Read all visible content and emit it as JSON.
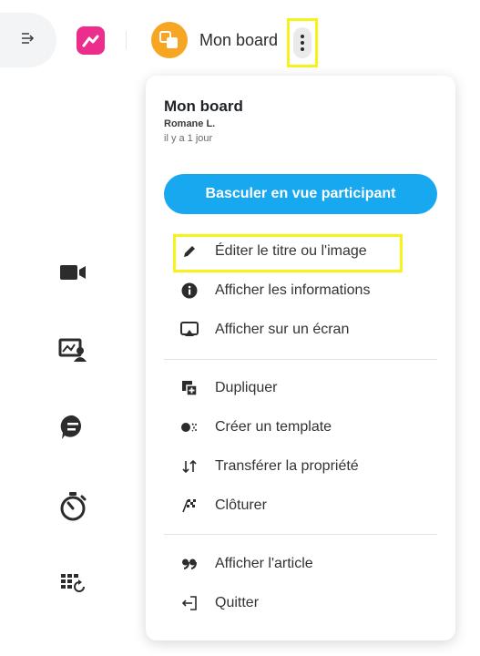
{
  "topbar": {
    "collapse_icon": "collapse-sidebar-icon",
    "app_logo_icon": "app-logo-icon",
    "board_avatar_icon": "board-avatar-icon",
    "board_title": "Mon board",
    "more_icon": "more-vertical-icon",
    "accent": "#ec2d8c",
    "avatar_color": "#f6a623",
    "highlight_color": "#f8f21b"
  },
  "sidebar": {
    "items": [
      {
        "icon": "video-icon"
      },
      {
        "icon": "presentation-icon"
      },
      {
        "icon": "chat-icon"
      },
      {
        "icon": "timer-icon"
      },
      {
        "icon": "grid-refresh-icon"
      }
    ]
  },
  "menu": {
    "title": "Mon board",
    "owner": "Romane L.",
    "time": "il y a 1 jour",
    "primary_button": "Basculer en vue participant",
    "primary_color": "#17a8ef",
    "items": [
      {
        "label": "Éditer le titre ou l'image",
        "icon": "pencil-icon"
      },
      {
        "label": "Afficher les informations",
        "icon": "info-icon"
      },
      {
        "label": "Afficher sur un écran",
        "icon": "cast-screen-icon"
      },
      {
        "label": "Dupliquer",
        "icon": "duplicate-icon"
      },
      {
        "label": "Créer un template",
        "icon": "template-icon"
      },
      {
        "label": "Transférer la propriété",
        "icon": "transfer-icon"
      },
      {
        "label": "Clôturer",
        "icon": "finish-flag-icon"
      },
      {
        "label": "Afficher l'article",
        "icon": "quote-icon"
      },
      {
        "label": "Quitter",
        "icon": "exit-icon"
      }
    ]
  }
}
